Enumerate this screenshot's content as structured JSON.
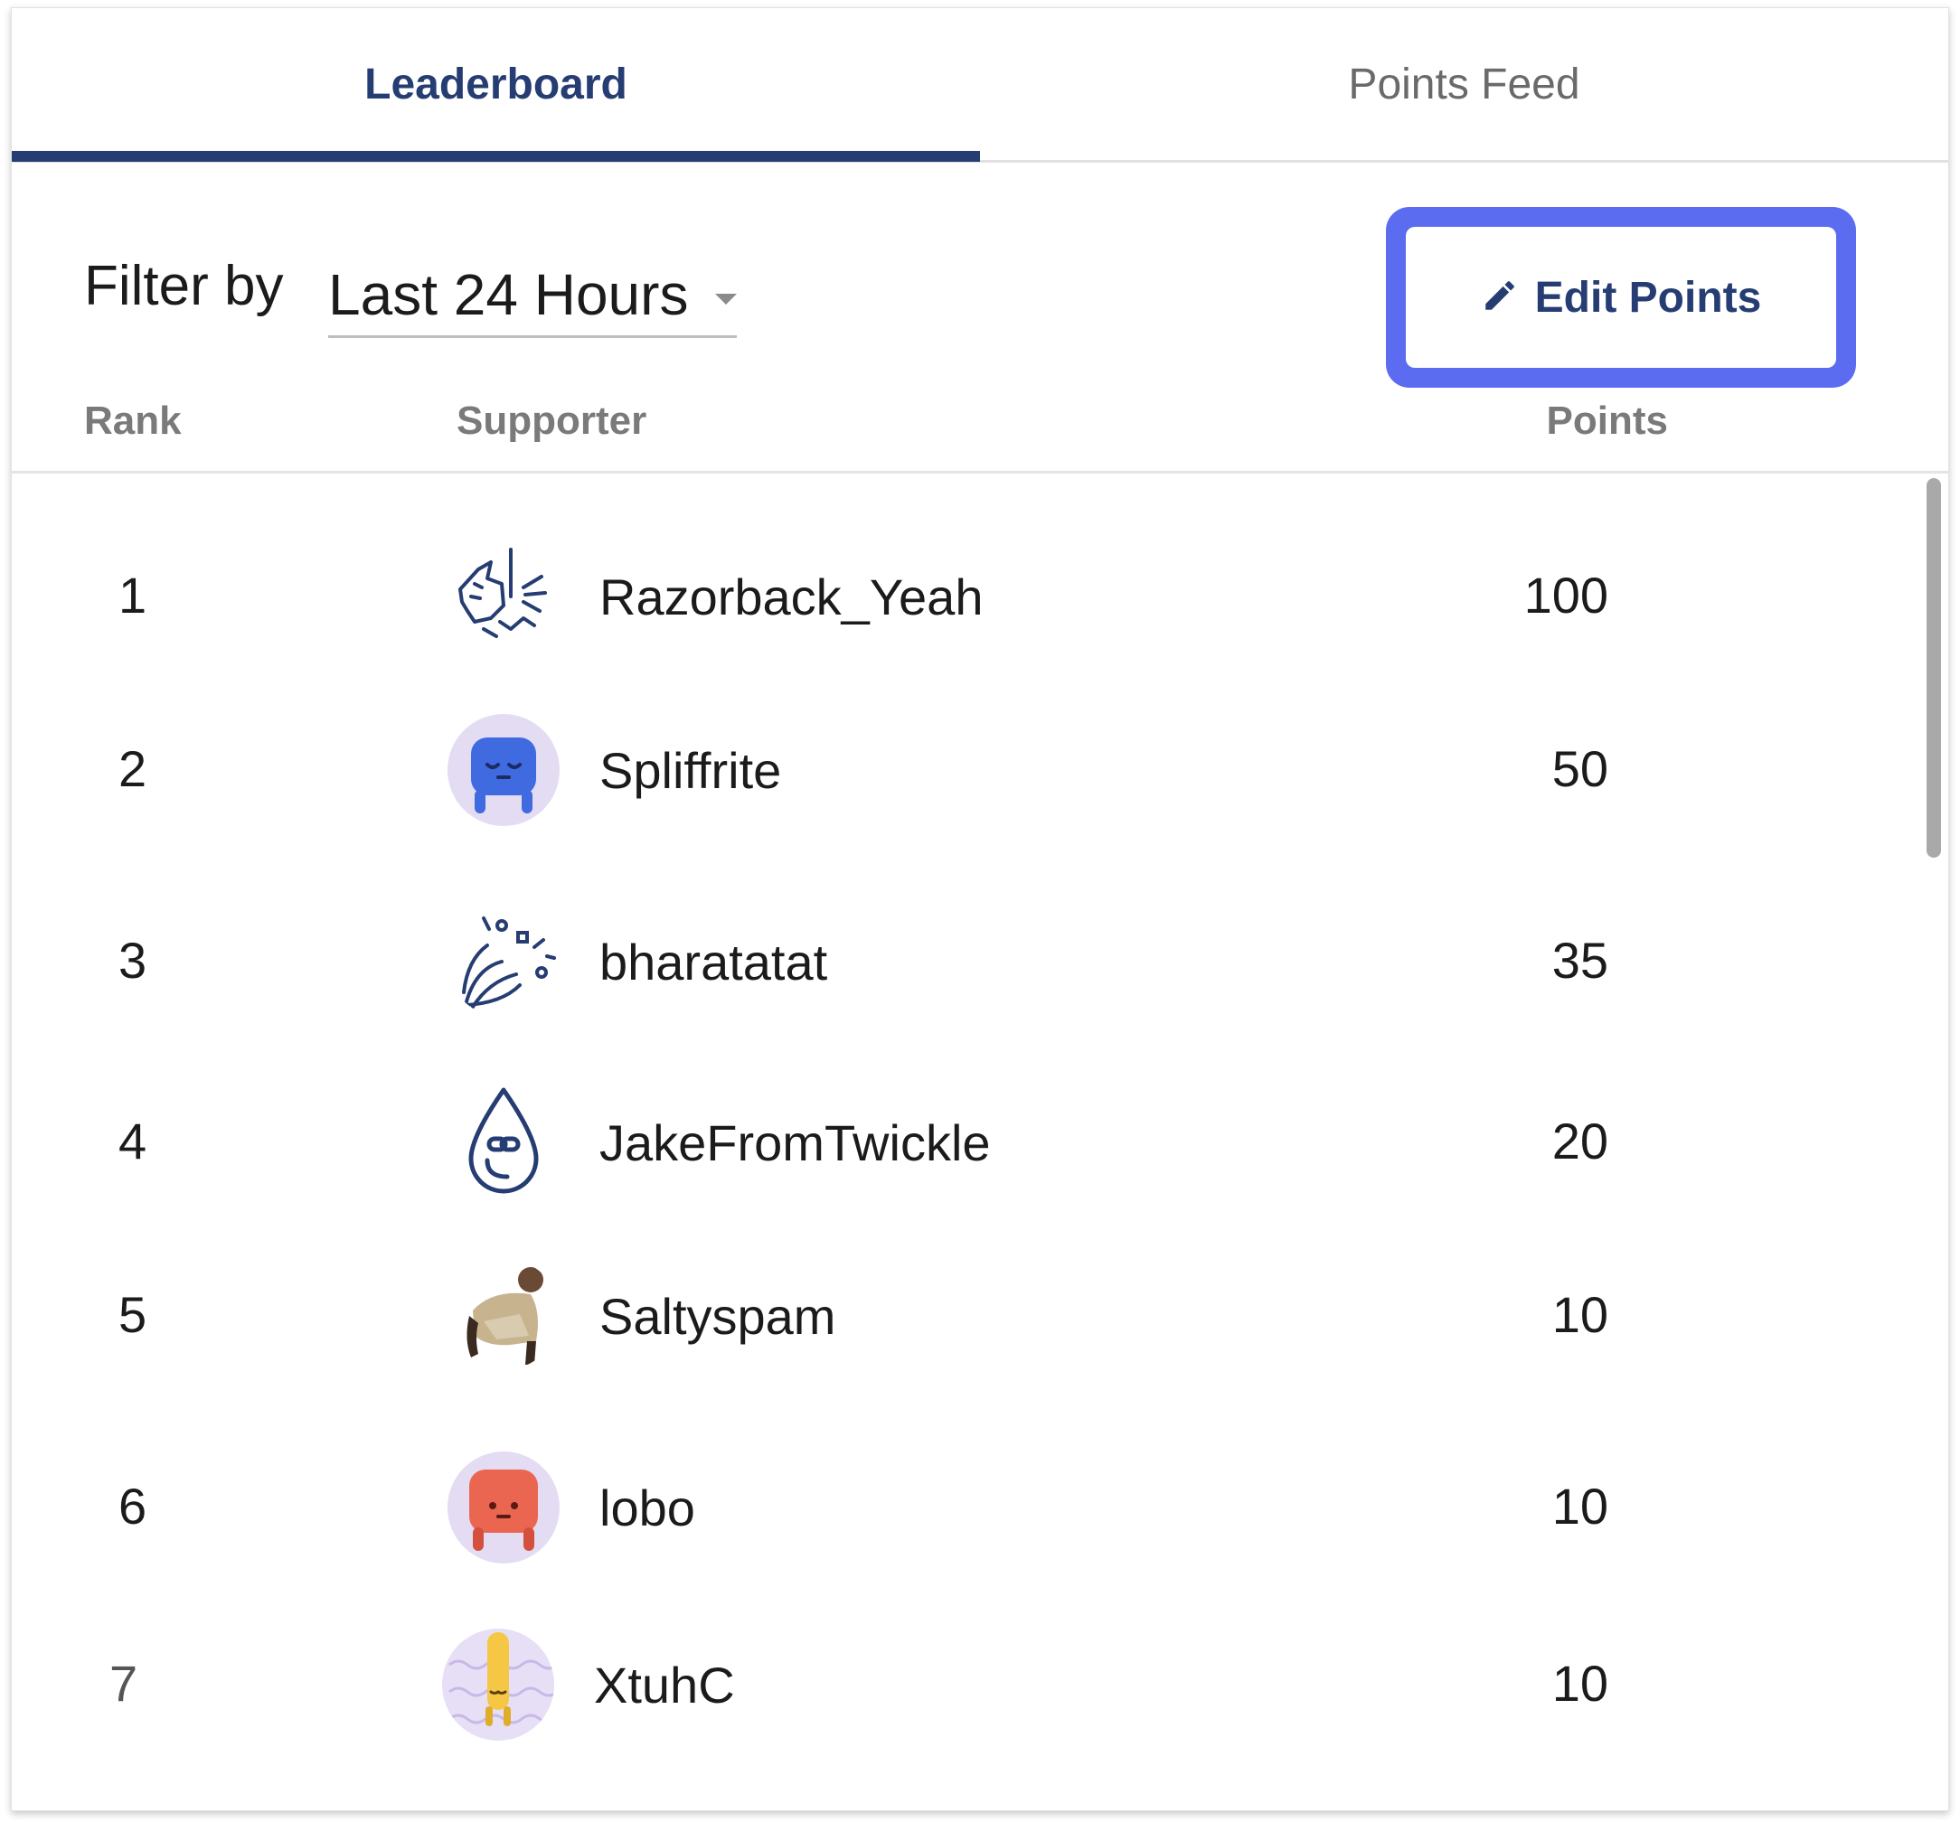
{
  "tabs": [
    {
      "label": "Leaderboard",
      "active": true
    },
    {
      "label": "Points Feed",
      "active": false
    }
  ],
  "filter": {
    "label": "Filter by",
    "selected": "Last 24 Hours"
  },
  "edit_button": {
    "label": "Edit Points",
    "icon": "pencil-icon"
  },
  "columns": {
    "rank": "Rank",
    "supporter": "Supporter",
    "points": "Points"
  },
  "rows": [
    {
      "rank": "1",
      "name": "Razorback_Yeah",
      "points": "100",
      "avatar": "line-art-creature-icon"
    },
    {
      "rank": "2",
      "name": "Spliffrite",
      "points": "50",
      "avatar": "blue-blob-avatar"
    },
    {
      "rank": "3",
      "name": "bharatatat",
      "points": "35",
      "avatar": "confetti-burst-icon"
    },
    {
      "rank": "4",
      "name": "JakeFromTwickle",
      "points": "20",
      "avatar": "water-drop-icon"
    },
    {
      "rank": "5",
      "name": "Saltyspam",
      "points": "10",
      "avatar": "person-photo-avatar"
    },
    {
      "rank": "6",
      "name": "lobo",
      "points": "10",
      "avatar": "red-blob-avatar"
    },
    {
      "rank": "7",
      "name": "XtuhC",
      "points": "10",
      "avatar": "yellow-blob-avatar"
    }
  ],
  "colors": {
    "accent": "#263d73",
    "focus_ring": "#5b6cf1",
    "header_text": "#7a7a7a"
  }
}
